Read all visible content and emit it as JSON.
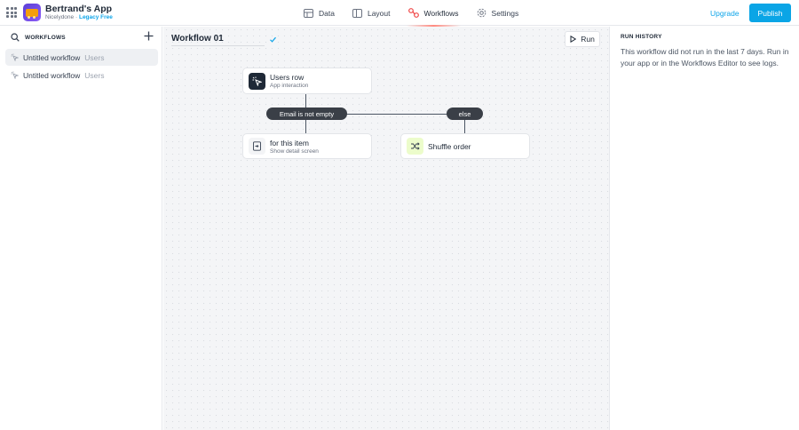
{
  "app": {
    "name": "Bertrand's App",
    "owner": "Nicelydone",
    "separator": "·",
    "plan": "Legacy Free"
  },
  "nav": {
    "items": [
      {
        "label": "Data",
        "icon": "table-icon"
      },
      {
        "label": "Layout",
        "icon": "layout-icon"
      },
      {
        "label": "Workflows",
        "icon": "workflows-icon",
        "active": true
      },
      {
        "label": "Settings",
        "icon": "gear-icon"
      }
    ]
  },
  "header": {
    "upgrade_label": "Upgrade",
    "publish_label": "Publish",
    "colors": {
      "publish": "#0aa5e6",
      "upgrade": "#0ea5e9"
    }
  },
  "sidebar": {
    "title": "WORKFLOWS",
    "items": [
      {
        "name": "Untitled workflow",
        "table": "Users",
        "selected": true
      },
      {
        "name": "Untitled workflow",
        "table": "Users",
        "selected": false
      }
    ]
  },
  "canvas": {
    "workflow_name": "Workflow 01",
    "run_label": "Run",
    "trigger": {
      "title": "Users row",
      "subtitle": "App interaction",
      "icon": "cursor-click-icon"
    },
    "condition": {
      "label": "Email is not empty"
    },
    "else_branch": {
      "label": "else"
    },
    "action_then": {
      "title": "for this item",
      "subtitle": "Show detail screen",
      "icon": "screen-icon"
    },
    "action_else": {
      "title": "Shuffle order",
      "icon": "shuffle-icon"
    }
  },
  "run_history": {
    "title": "RUN HISTORY",
    "message": "This workflow did not run in the last 7 days. Run in your app or in the Workflows Editor to see logs."
  }
}
